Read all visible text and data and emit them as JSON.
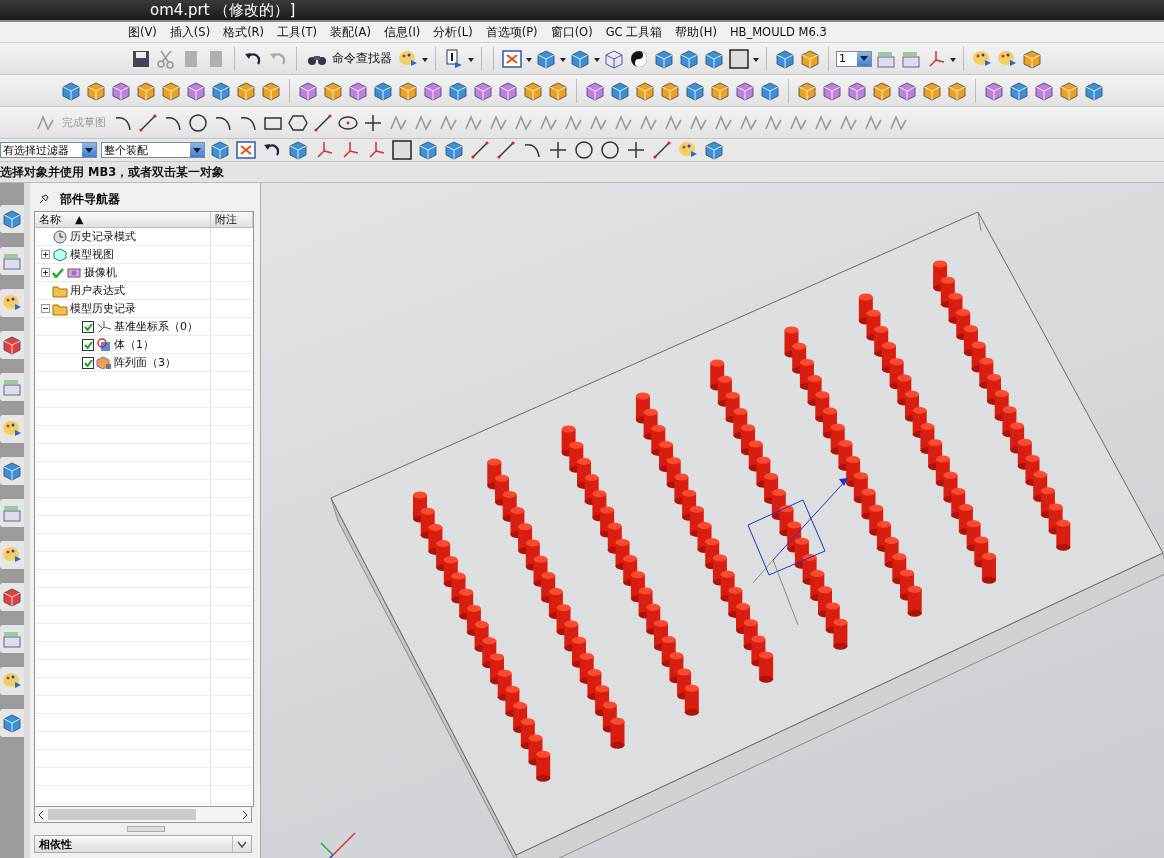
{
  "window": {
    "title": "om4.prt （修改的）]"
  },
  "menu": [
    "图(V)",
    "插入(S)",
    "格式(R)",
    "工具(T)",
    "装配(A)",
    "信息(I)",
    "分析(L)",
    "首选项(P)",
    "窗口(O)",
    "GC 工具箱",
    "帮助(H)",
    "HB_MOULD M6.3"
  ],
  "toolbar": {
    "command_finder": "命令查找器",
    "layer": "1",
    "finish_sketch": {
      "label": "完成草图",
      "disabled": true
    }
  },
  "selection_bar": {
    "filter": "有选择过滤器",
    "scope": "整个装配"
  },
  "status": "选择对象并使用 MB3，或者双击某一对象",
  "navigator": {
    "title": "部件导航器",
    "columns": [
      {
        "label": "名称",
        "sort": "▲"
      },
      {
        "label": "附注"
      }
    ],
    "items": [
      {
        "label": "历史记录模式",
        "kind": "clock"
      },
      {
        "label": "模型视图",
        "kind": "views",
        "expanded": false
      },
      {
        "label": "摄像机",
        "kind": "camera",
        "expanded": false,
        "visible": true
      },
      {
        "label": "用户表达式",
        "kind": "folder"
      },
      {
        "label": "模型历史记录",
        "kind": "folder",
        "expanded": true,
        "children": [
          {
            "label": "基准坐标系（0）",
            "kind": "datum",
            "checked": true
          },
          {
            "label": "体（1）",
            "kind": "body",
            "checked": true
          },
          {
            "label": "阵列面（3）",
            "kind": "pattern",
            "checked": true
          }
        ]
      }
    ]
  },
  "panels": [
    {
      "title": "相依性",
      "expanded": false
    }
  ]
}
